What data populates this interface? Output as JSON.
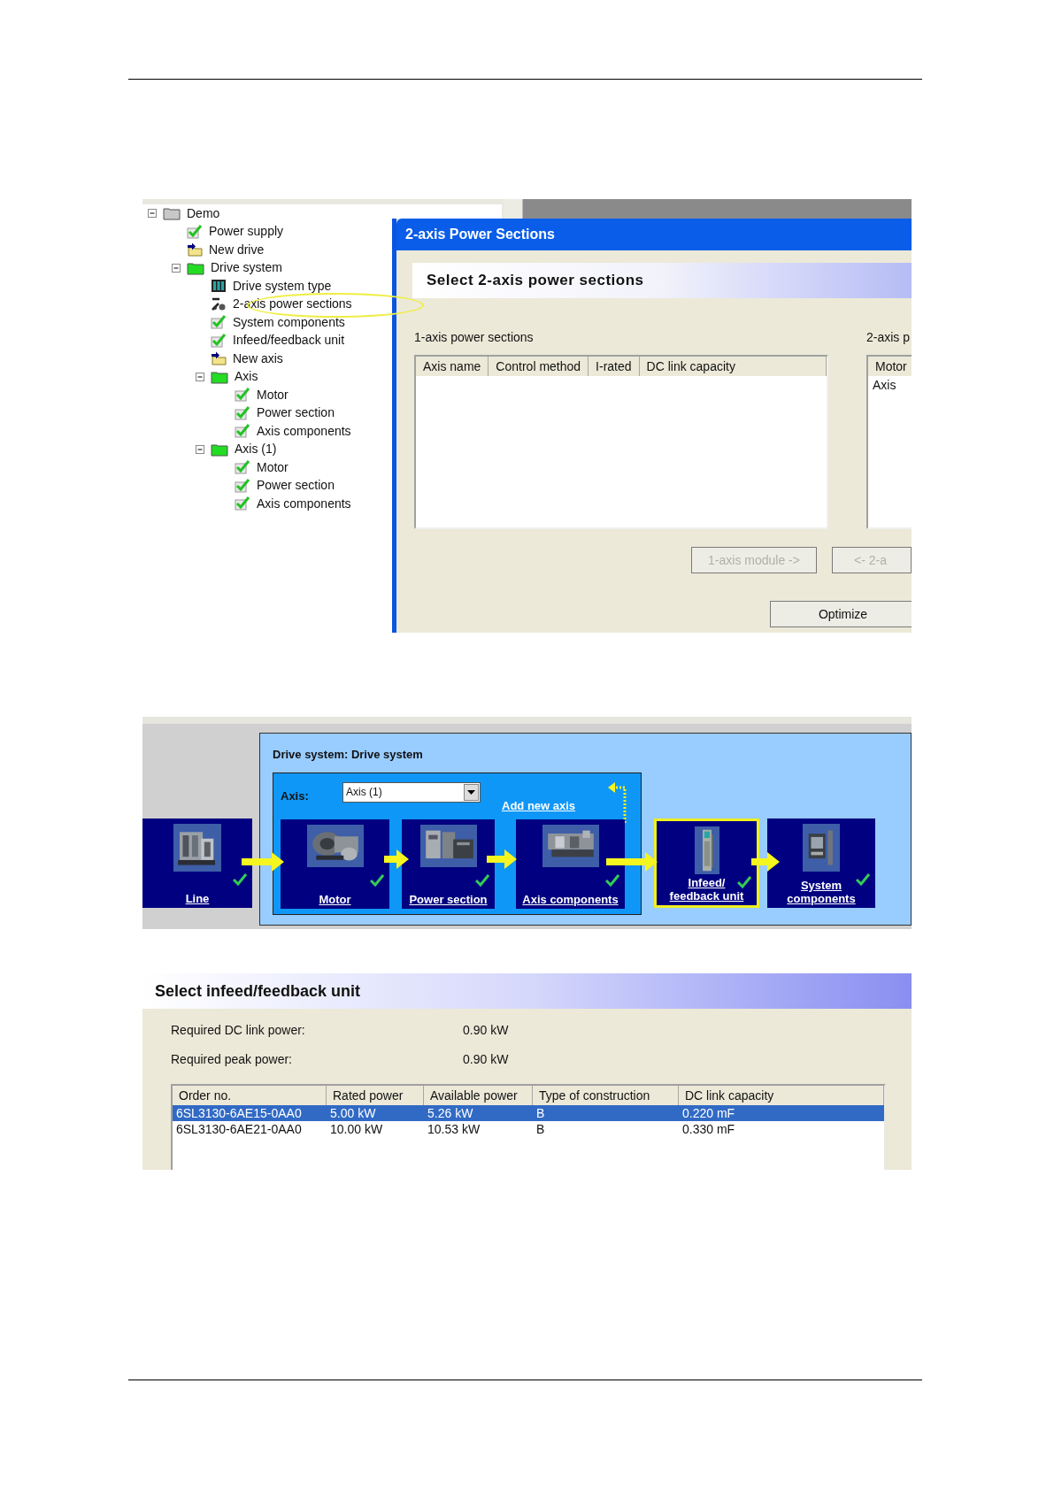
{
  "tree": {
    "items": [
      {
        "label": "Demo",
        "kind": "folder-gray",
        "expanded": true,
        "circled": false,
        "children": [
          {
            "label": "Power supply",
            "kind": "check",
            "circled": false
          },
          {
            "label": "New drive",
            "kind": "new",
            "circled": false
          },
          {
            "label": "Drive system",
            "kind": "folder-green",
            "expanded": true,
            "circled": false,
            "children": [
              {
                "label": "Drive system type",
                "kind": "module",
                "circled": false
              },
              {
                "label": "2-axis power sections",
                "kind": "tool",
                "circled": true
              },
              {
                "label": "System components",
                "kind": "check",
                "circled": false
              },
              {
                "label": "Infeed/feedback unit",
                "kind": "check",
                "circled": false
              },
              {
                "label": "New axis",
                "kind": "new",
                "circled": false
              },
              {
                "label": "Axis",
                "kind": "folder-green",
                "expanded": true,
                "circled": false,
                "children": [
                  {
                    "label": "Motor",
                    "kind": "check",
                    "circled": false
                  },
                  {
                    "label": "Power section",
                    "kind": "check",
                    "circled": false
                  },
                  {
                    "label": "Axis components",
                    "kind": "check",
                    "circled": false
                  }
                ]
              },
              {
                "label": "Axis (1)",
                "kind": "folder-green",
                "expanded": true,
                "circled": false,
                "children": [
                  {
                    "label": "Motor",
                    "kind": "check",
                    "circled": false
                  },
                  {
                    "label": "Power section",
                    "kind": "check",
                    "circled": false
                  },
                  {
                    "label": "Axis components",
                    "kind": "check",
                    "circled": false
                  }
                ]
              }
            ]
          }
        ]
      }
    ]
  },
  "dialog": {
    "title": "2-axis Power Sections",
    "header": "Select 2-axis power sections",
    "left_list": {
      "label": "1-axis power sections",
      "columns": [
        "Axis name",
        "Control method",
        "I-rated",
        "DC link capacity"
      ]
    },
    "right_list": {
      "label": "2-axis p",
      "columns": [
        "Motor"
      ],
      "rows": [
        "Axis"
      ]
    },
    "move_buttons": [
      {
        "label": "1-axis module ->",
        "disabled": true
      },
      {
        "label": "<- 2-a",
        "disabled": true
      }
    ],
    "optimize_button": {
      "label": "Optimize",
      "disabled": false
    }
  },
  "drive_system": {
    "title": "Drive system: Drive system",
    "axis_label": "Axis:",
    "axis_value": "Axis (1)",
    "add_link": "Add new axis",
    "line_step": {
      "label": "Line",
      "done": true,
      "selected": false
    },
    "axis_steps": [
      {
        "label": "Motor",
        "done": true,
        "selected": false
      },
      {
        "label": "Power section",
        "done": true,
        "selected": false
      },
      {
        "label": "Axis components",
        "done": true,
        "selected": false
      }
    ],
    "unit_steps": [
      {
        "label": "Infeed/ feedback unit",
        "done": true,
        "selected": true
      },
      {
        "label": "System components",
        "done": true,
        "selected": false
      }
    ]
  },
  "infeed": {
    "header": "Select infeed/feedback unit",
    "info": [
      {
        "label": "Required DC link power:",
        "value": "0.90 kW"
      },
      {
        "label": "Required peak power:",
        "value": "0.90 kW"
      }
    ],
    "table": {
      "columns": [
        "Order no.",
        "Rated power",
        "Available power",
        "Type of construction",
        "DC link capacity"
      ],
      "rows": [
        {
          "cells": [
            "6SL3130-6AE15-0AA0",
            "5.00 kW",
            "5.26 kW",
            "B",
            "0.220 mF"
          ],
          "selected": true
        },
        {
          "cells": [
            "6SL3130-6AE21-0AA0",
            "10.00 kW",
            "10.53 kW",
            "B",
            "0.330 mF"
          ],
          "selected": false
        }
      ]
    }
  }
}
